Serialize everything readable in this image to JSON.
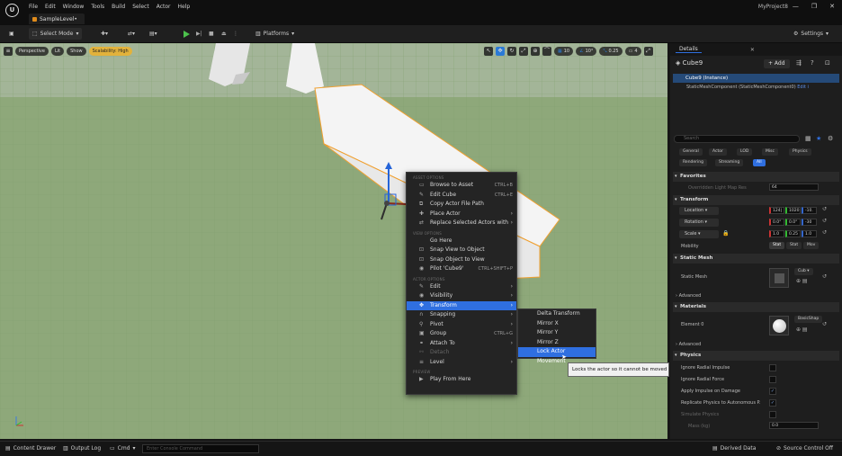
{
  "titlebar": {
    "menu": [
      "File",
      "Edit",
      "Window",
      "Tools",
      "Build",
      "Select",
      "Actor",
      "Help"
    ],
    "level_tab": "SampleLevel•",
    "project": "MyProject8",
    "win_buttons": [
      "—",
      "❐",
      "✕"
    ]
  },
  "toolbar": {
    "select_mode": "Select Mode",
    "platforms": "Platforms",
    "settings": "Settings"
  },
  "viewport": {
    "perspective": "Perspective",
    "lit": "Lit",
    "show": "Show",
    "scalability": "Scalability: High",
    "grid_snap": "10",
    "angle_snap": "10°",
    "scale_snap": "0.25",
    "camera_speed": "4"
  },
  "context_menu": {
    "sections": {
      "asset": "ASSET OPTIONS",
      "view": "VIEW OPTIONS",
      "actor": "ACTOR OPTIONS",
      "preview": "PREVIEW"
    },
    "asset_items": [
      {
        "label": "Browse to Asset",
        "shortcut": "CTRL+B"
      },
      {
        "label": "Edit Cube",
        "shortcut": "CTRL+E"
      },
      {
        "label": "Copy Actor File Path",
        "shortcut": ""
      },
      {
        "label": "Place Actor",
        "shortcut": ""
      },
      {
        "label": "Replace Selected Actors with",
        "shortcut": ""
      }
    ],
    "view_items": [
      {
        "label": "Go Here",
        "shortcut": ""
      },
      {
        "label": "Snap View to Object",
        "shortcut": ""
      },
      {
        "label": "Snap Object to View",
        "shortcut": ""
      },
      {
        "label": "Pilot 'Cube9'",
        "shortcut": "CTRL+SHIFT+P"
      }
    ],
    "actor_items": [
      {
        "label": "Edit",
        "shortcut": ""
      },
      {
        "label": "Visibility",
        "shortcut": ""
      },
      {
        "label": "Transform",
        "shortcut": ""
      },
      {
        "label": "Snapping",
        "shortcut": ""
      },
      {
        "label": "Pivot",
        "shortcut": ""
      },
      {
        "label": "Group",
        "shortcut": "CTRL+G"
      },
      {
        "label": "Attach To",
        "shortcut": ""
      },
      {
        "label": "Detach",
        "shortcut": ""
      },
      {
        "label": "Level",
        "shortcut": ""
      }
    ],
    "preview_items": [
      {
        "label": "Play From Here",
        "shortcut": ""
      }
    ]
  },
  "transform_submenu": [
    "Delta Transform",
    "Mirror X",
    "Mirror Y",
    "Mirror Z",
    "Lock Actor Movement"
  ],
  "tooltip": "Locks the actor so it cannot be moved",
  "details": {
    "tab": "Details",
    "actor_name": "Cube9",
    "add_label": "+ Add",
    "instance": "Cube9 (Instance)",
    "component": "StaticMeshComponent (StaticMeshComponent0)",
    "edit_link": "Edit i",
    "search_placeholder": "Search",
    "filters_row1": [
      "General",
      "Actor",
      "LOD",
      "Misc",
      "Physics"
    ],
    "filters_row2": [
      "Rendering",
      "Streaming",
      "All"
    ],
    "favorites": "Favorites",
    "override_light": "Overridden Light Map Res",
    "override_value": "64",
    "transform": "Transform",
    "location": "Location",
    "location_vals": [
      "124|",
      "1020",
      "-10."
    ],
    "rotation": "Rotation",
    "rotation_vals": [
      "0.0°",
      "0.0°",
      "-30"
    ],
    "scale": "Scale",
    "scale_vals": [
      "1.0",
      "0.25",
      "1.0"
    ],
    "mobility": "Mobility",
    "mobility_opts": [
      "Stat",
      "Stat",
      "Mov"
    ],
    "static_mesh_sec": "Static Mesh",
    "static_mesh": "Static Mesh",
    "mesh_value": "Cub",
    "advanced": "Advanced",
    "materials": "Materials",
    "element0": "Element 0",
    "material_value": "BasicShap",
    "physics": "Physics",
    "physics_props": [
      {
        "label": "Ignore Radial Impulse",
        "checked": false
      },
      {
        "label": "Ignore Radial Force",
        "checked": false
      },
      {
        "label": "Apply Impulse on Damage",
        "checked": true
      },
      {
        "label": "Replicate Physics to Autonomous P.",
        "checked": true
      },
      {
        "label": "Simulate Physics",
        "checked": false
      },
      {
        "label": "Mass (kg)",
        "checked": false
      }
    ],
    "mass_value": "0.0"
  },
  "statusbar": {
    "content_drawer": "Content Drawer",
    "output_log": "Output Log",
    "cmd": "Cmd",
    "console_placeholder": "Enter Console Command",
    "derived_data": "Derived Data",
    "source_control": "Source Control Off"
  },
  "colors": {
    "accent": "#2f6fe0",
    "selection_outline": "#f0a030",
    "grid_floor": "#8ea87a"
  }
}
